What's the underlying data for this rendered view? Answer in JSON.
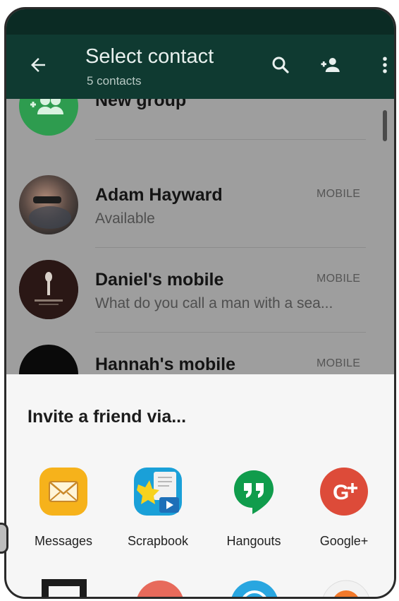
{
  "appbar": {
    "title": "Select contact",
    "subtitle": "5 contacts",
    "icons": [
      "back-arrow-icon",
      "search-icon",
      "add-contact-icon",
      "more-vert-icon"
    ],
    "color": "#0f3a31"
  },
  "contacts": [
    {
      "name": "New group"
    },
    {
      "name": "Adam Hayward",
      "status": "Available",
      "type": "MOBILE"
    },
    {
      "name": "Daniel's mobile",
      "status": "What do you call a man with a sea...",
      "type": "MOBILE"
    },
    {
      "name": "Hannah's mobile",
      "type": "MOBILE"
    }
  ],
  "share_sheet": {
    "heading": "Invite a friend via...",
    "apps": [
      {
        "label": "Messages",
        "icon": "messages-icon"
      },
      {
        "label": "Scrapbook",
        "icon": "scrapbook-icon"
      },
      {
        "label": "Hangouts",
        "icon": "hangouts-icon"
      },
      {
        "label": "Google+",
        "icon": "google-plus-icon"
      }
    ]
  }
}
